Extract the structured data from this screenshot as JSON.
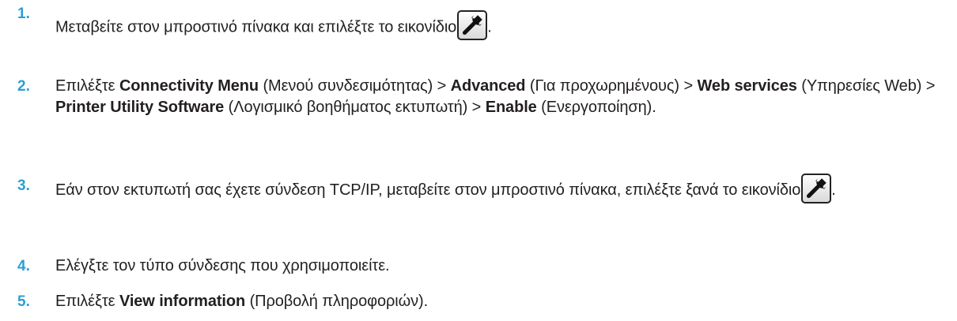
{
  "steps": [
    {
      "number": "1.",
      "text_before_icon": "Μεταβείτε στον μπροστινό πίνακα και επιλέξτε το εικονίδιο",
      "text_after_icon": "."
    },
    {
      "number": "2.",
      "t1": "Επιλέξτε ",
      "b1": "Connectivity Menu",
      "t2": " (Μενού συνδεσιμότητας) > ",
      "b2": "Advanced",
      "t3": " (Για προχωρημένους) > ",
      "b3": "Web services",
      "t4": " (Υπηρεσίες Web) > ",
      "b4": "Printer Utility Software",
      "t5": " (Λογισμικό βοηθήματος εκτυπωτή) > ",
      "b5": "Enable",
      "t6": " (Ενεργοποίηση)."
    },
    {
      "number": "3.",
      "text_before_icon": "Εάν στον εκτυπωτή σας έχετε σύνδεση TCP/IP, μεταβείτε στον μπροστινό πίνακα, επιλέξτε ξανά το εικονίδιο",
      "text_after_icon": "."
    },
    {
      "number": "4.",
      "text": "Ελέγξτε τον τύπο σύνδεσης που χρησιμοποιείτε."
    },
    {
      "number": "5.",
      "t1": "Επιλέξτε ",
      "b1": "View information",
      "t2": " (Προβολή πληροφοριών)."
    }
  ],
  "icons": {
    "settings": "wrench-icon"
  },
  "colors": {
    "step_number": "#2a9fd6",
    "text": "#231f20"
  }
}
